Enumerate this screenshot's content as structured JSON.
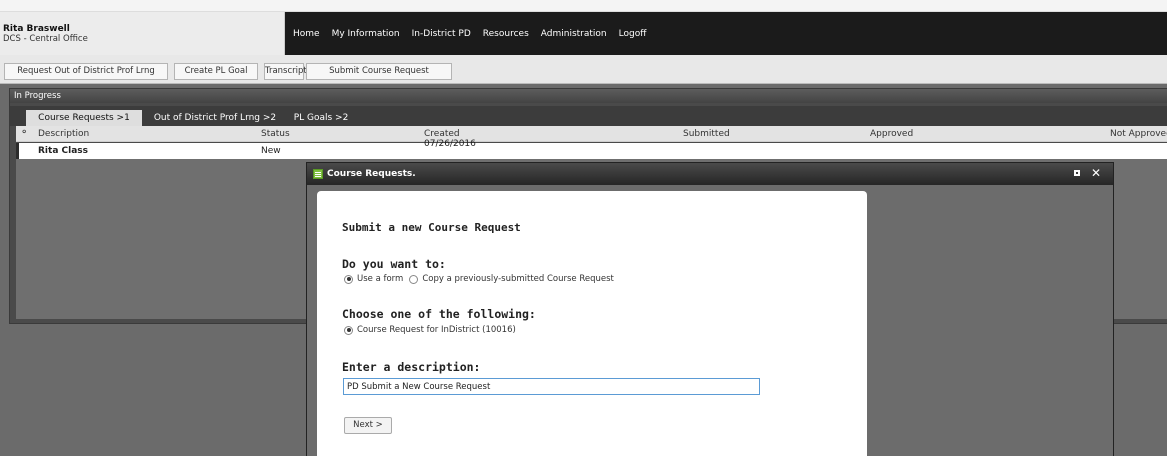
{
  "user": {
    "name": "Rita Braswell",
    "org": "DCS - Central Office"
  },
  "nav": [
    "Home",
    "My Information",
    "In-District PD",
    "Resources",
    "Administration",
    "Logoff"
  ],
  "subnav": [
    "Request Out of District Prof Lrng",
    "Create PL Goal",
    "Transcript",
    "Submit Course Request"
  ],
  "panel": {
    "title": "In Progress",
    "tabs": [
      "Course Requests >1",
      "Out of District Prof Lrng >2",
      "PL Goals >2"
    ],
    "columns": [
      "Description",
      "Status",
      "Created",
      "Submitted",
      "Approved",
      "Not Approved"
    ],
    "rows": [
      {
        "description": "Rita Class",
        "status": "New",
        "created": "07/26/2016"
      }
    ]
  },
  "modal": {
    "title": "Course Requests.",
    "form_title": "Submit a new Course Request",
    "q1": {
      "label": "Do you want to:",
      "option1": "Use a form",
      "option2": "Copy a previously-submitted Course Request",
      "selected": "Use a form"
    },
    "q2": {
      "label": "Choose one of the following:",
      "option1": "Course Request for InDistrict (10016)"
    },
    "q3": {
      "label": "Enter a description:",
      "value": "PD Submit a New Course Request"
    },
    "next_label": "Next >"
  }
}
